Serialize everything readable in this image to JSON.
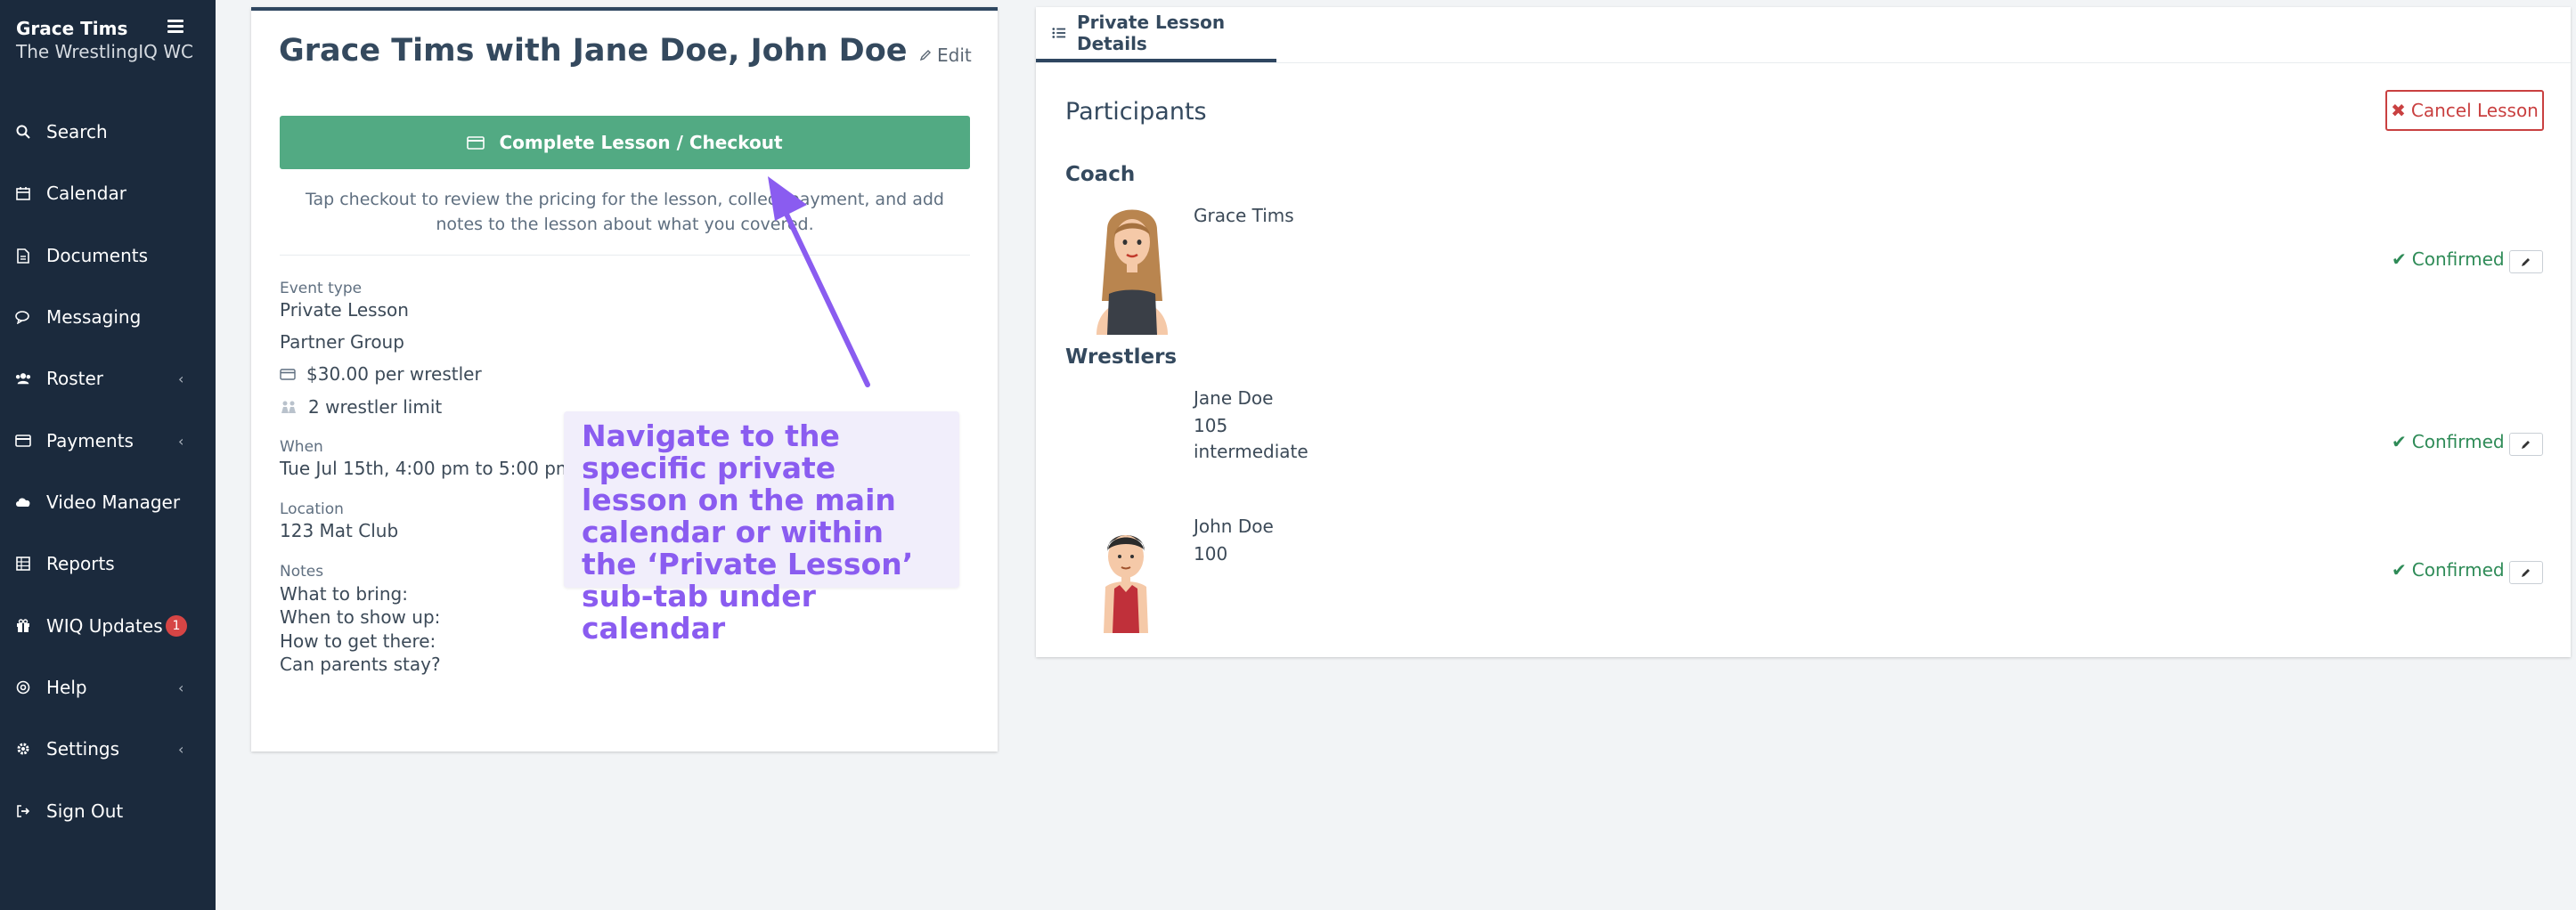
{
  "sidebar": {
    "user_name": "Grace Tims",
    "org_name": "The WrestlingIQ WC",
    "items": [
      {
        "label": "Search",
        "icon": "search-icon"
      },
      {
        "label": "Calendar",
        "icon": "calendar-icon"
      },
      {
        "label": "Documents",
        "icon": "document-icon"
      },
      {
        "label": "Messaging",
        "icon": "chat-icon"
      },
      {
        "label": "Roster",
        "icon": "users-icon"
      },
      {
        "label": "Payments",
        "icon": "credit-card-icon"
      },
      {
        "label": "Video Manager",
        "icon": "cloud-icon"
      },
      {
        "label": "Reports",
        "icon": "table-icon"
      },
      {
        "label": "WIQ Updates",
        "icon": "gift-icon",
        "badge": "1"
      },
      {
        "label": "Help",
        "icon": "globe-icon"
      },
      {
        "label": "Settings",
        "icon": "gear-icon"
      },
      {
        "label": "Sign Out",
        "icon": "sign-out-icon"
      }
    ]
  },
  "lesson": {
    "title": "Grace Tims with Jane Doe, John Doe",
    "edit_label": "Edit",
    "checkout_label": "Complete Lesson / Checkout",
    "checkout_hint": "Tap checkout to review the pricing for the lesson, collect payment, and add notes to the lesson about what you covered.",
    "event_type_label": "Event type",
    "event_type": "Private Lesson",
    "group_type": "Partner Group",
    "price": "$30.00 per wrestler",
    "limit": "2 wrestler limit",
    "when_label": "When",
    "when": "Tue Jul 15th, 4:00 pm to 5:00 pm",
    "location_label": "Location",
    "location": "123 Mat Club",
    "notes_label": "Notes",
    "notes": [
      "What to bring:",
      "When to show up:",
      "How to get there:",
      "Can parents stay?"
    ]
  },
  "callout": {
    "text": "Navigate to the specific private lesson on the main calendar or within the ‘Private Lesson’ sub-tab under calendar"
  },
  "details": {
    "tab_label": "Private Lesson Details",
    "participants_title": "Participants",
    "cancel_label": "Cancel Lesson",
    "coach_title": "Coach",
    "wrestlers_title": "Wrestlers",
    "coach": {
      "name": "Grace Tims",
      "status": "Confirmed"
    },
    "wrestlers": [
      {
        "name": "Jane Doe",
        "weight": "105",
        "level": "intermediate",
        "status": "Confirmed"
      },
      {
        "name": "John Doe",
        "weight": "100",
        "status": "Confirmed"
      }
    ]
  },
  "colors": {
    "sidebar_bg": "#1b2a3d",
    "checkout_green": "#52aa83",
    "cancel_red": "#c94040",
    "confirmed_green": "#2e8b57",
    "callout_purple": "#8a5cf0"
  }
}
